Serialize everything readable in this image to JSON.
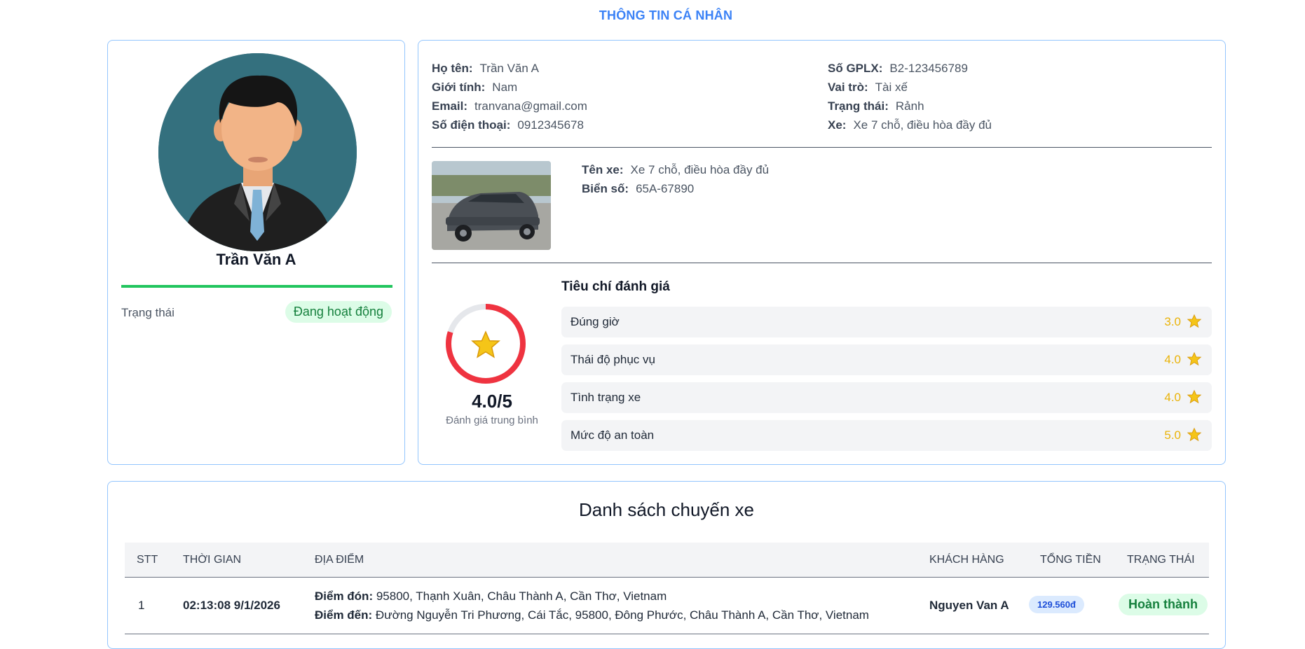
{
  "page_title": "THÔNG TIN CÁ NHÂN",
  "profile": {
    "name": "Trần Văn A",
    "status_label": "Trạng thái",
    "status_value": "Đang hoạt động"
  },
  "info": {
    "full_name_label": "Họ tên:",
    "full_name": "Trần Văn A",
    "gender_label": "Giới tính:",
    "gender": "Nam",
    "email_label": "Email:",
    "email": "tranvana@gmail.com",
    "phone_label": "Số điện thoại:",
    "phone": "0912345678",
    "license_label": "Số GPLX:",
    "license": "B2-123456789",
    "role_label": "Vai trò:",
    "role": "Tài xế",
    "state_label": "Trạng thái:",
    "state": "Rảnh",
    "vehicle_label": "Xe:",
    "vehicle": "Xe 7 chỗ, điều hòa đầy đủ"
  },
  "car": {
    "name_label": "Tên xe:",
    "name": "Xe 7 chỗ, điều hòa đầy đủ",
    "plate_label": "Biển số:",
    "plate": "65A-67890"
  },
  "rating": {
    "average": "4.0/5",
    "average_fraction": 0.8,
    "caption": "Đánh giá trung bình",
    "criteria_title": "Tiêu chí đánh giá",
    "criteria": [
      {
        "label": "Đúng giờ",
        "score": "3.0"
      },
      {
        "label": "Thái độ phục vụ",
        "score": "4.0"
      },
      {
        "label": "Tình trạng xe",
        "score": "4.0"
      },
      {
        "label": "Mức độ an toàn",
        "score": "5.0"
      }
    ],
    "colors": {
      "ring": "#ef3340",
      "ring_track": "#e5e7eb",
      "star": "#eab308"
    }
  },
  "trips": {
    "title": "Danh sách chuyến xe",
    "headers": [
      "STT",
      "THỜI GIAN",
      "ĐỊA ĐIỂM",
      "KHÁCH HÀNG",
      "TỔNG TIỀN",
      "TRẠNG THÁI"
    ],
    "rows": [
      {
        "index": "1",
        "time": "02:13:08 9/1/2026",
        "pickup_label": "Điểm đón:",
        "pickup": "95800, Thạnh Xuân, Châu Thành A, Cần Thơ, Vietnam",
        "dropoff_label": "Điểm đến:",
        "dropoff": "Đường Nguyễn Tri Phương, Cái Tắc, 95800, Đông Phước, Châu Thành A, Cần Thơ, Vietnam",
        "customer": "Nguyen Van A",
        "total": "129.560đ",
        "status": "Hoàn thành"
      }
    ]
  }
}
